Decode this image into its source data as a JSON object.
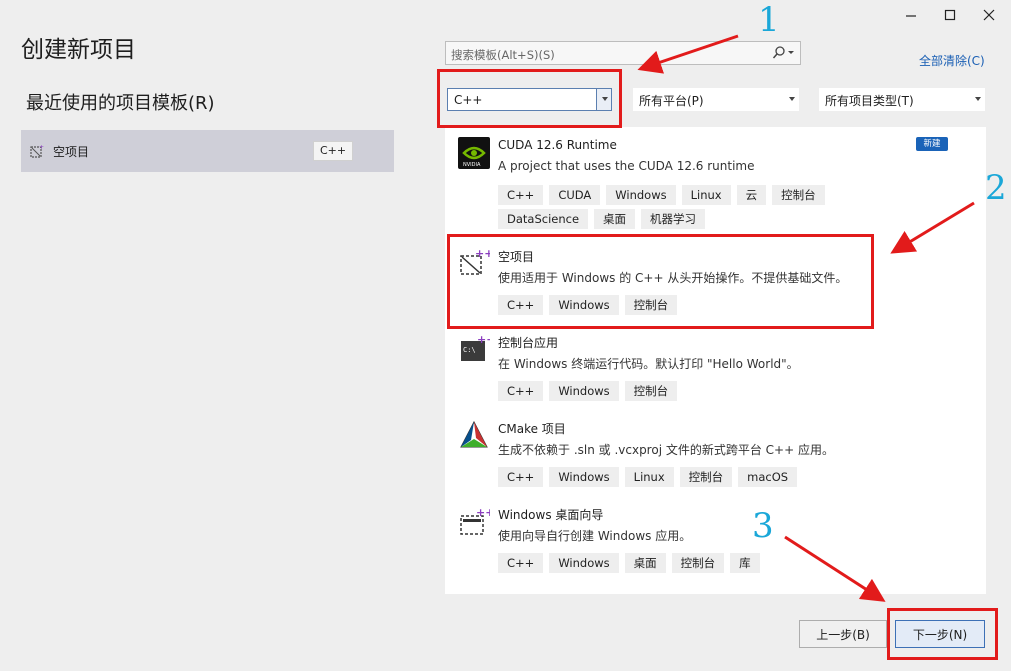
{
  "window": {
    "title": "创建新项目",
    "controls": [
      "minimize-icon",
      "maximize-icon",
      "close-icon"
    ]
  },
  "recent": {
    "heading": "最近使用的项目模板(R)",
    "items": [
      {
        "label": "空项目",
        "tag": "C++"
      }
    ]
  },
  "search": {
    "placeholder": "搜索模板(Alt+S)(S)",
    "clear_all": "全部清除(C)"
  },
  "filters": {
    "language": "C++",
    "platform": "所有平台(P)",
    "project_type": "所有项目类型(T)"
  },
  "templates": [
    {
      "name": "CUDA 12.6 Runtime",
      "desc": "A project that uses the CUDA 12.6 runtime",
      "badge": "新建",
      "tags": [
        "C++",
        "CUDA",
        "Windows",
        "Linux",
        "云",
        "控制台",
        "DataScience",
        "桌面",
        "机器学习"
      ]
    },
    {
      "name": "空项目",
      "desc": "使用适用于 Windows 的 C++ 从头开始操作。不提供基础文件。",
      "tags": [
        "C++",
        "Windows",
        "控制台"
      ]
    },
    {
      "name": "控制台应用",
      "desc": "在 Windows 终端运行代码。默认打印 \"Hello World\"。",
      "tags": [
        "C++",
        "Windows",
        "控制台"
      ]
    },
    {
      "name": "CMake 项目",
      "desc": "生成不依赖于 .sln 或 .vcxproj 文件的新式跨平台 C++ 应用。",
      "tags": [
        "C++",
        "Windows",
        "Linux",
        "控制台",
        "macOS"
      ]
    },
    {
      "name": "Windows 桌面向导",
      "desc": "使用向导自行创建 Windows 应用。",
      "tags": [
        "C++",
        "Windows",
        "桌面",
        "控制台",
        "库"
      ]
    }
  ],
  "footer": {
    "back": "上一步(B)",
    "next": "下一步(N)"
  },
  "annotations": {
    "step1": "1",
    "step2": "2",
    "step3": "3",
    "color": "#e21b1b",
    "number_color": "#1aa7d8"
  }
}
